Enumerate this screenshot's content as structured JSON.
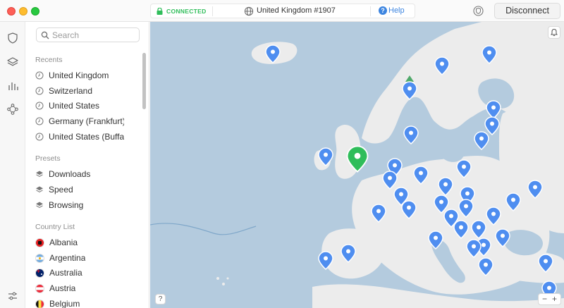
{
  "titlebar": {
    "status": "CONNECTED",
    "server": "United Kingdom #1907",
    "help_label": "Help",
    "disconnect_label": "Disconnect"
  },
  "sidebar": {
    "search_placeholder": "Search",
    "recents_title": "Recents",
    "recents": [
      {
        "label": "United Kingdom"
      },
      {
        "label": "Switzerland"
      },
      {
        "label": "United States"
      },
      {
        "label": "Germany (Frankfurt)"
      },
      {
        "label": "United States (Buffalo)"
      }
    ],
    "presets_title": "Presets",
    "presets": [
      {
        "label": "Downloads"
      },
      {
        "label": "Speed"
      },
      {
        "label": "Browsing"
      }
    ],
    "countries_title": "Country List",
    "countries": [
      {
        "label": "Albania"
      },
      {
        "label": "Argentina"
      },
      {
        "label": "Australia"
      },
      {
        "label": "Austria"
      },
      {
        "label": "Belgium"
      }
    ]
  },
  "map": {
    "help_label": "?",
    "zoom_out_label": "−",
    "zoom_in_label": "+",
    "connected_color": "#2fbd5a",
    "server_color": "#4f8ef0"
  }
}
